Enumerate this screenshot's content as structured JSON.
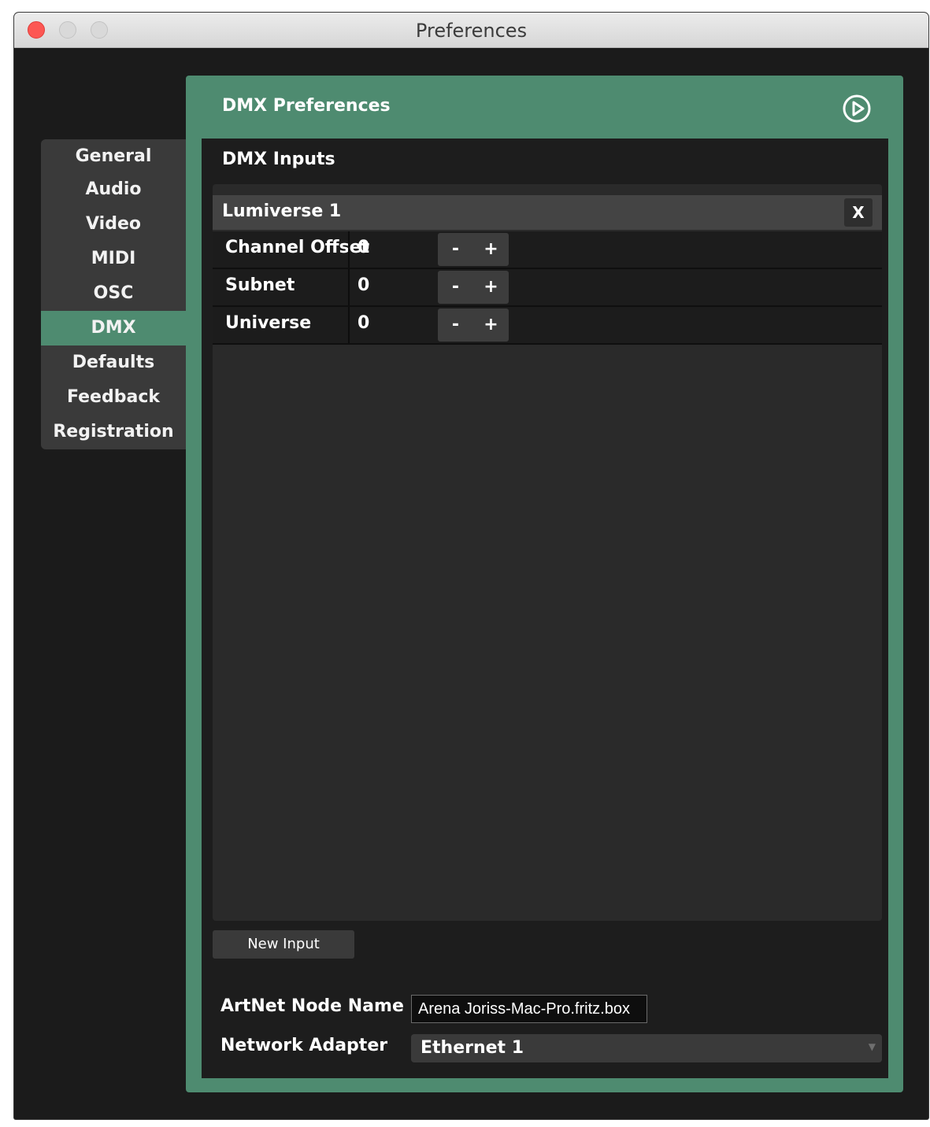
{
  "window": {
    "title": "Preferences"
  },
  "sidebar": {
    "items": [
      {
        "label": "General"
      },
      {
        "label": "Audio"
      },
      {
        "label": "Video"
      },
      {
        "label": "MIDI"
      },
      {
        "label": "OSC"
      },
      {
        "label": "DMX",
        "active": true
      },
      {
        "label": "Defaults"
      },
      {
        "label": "Feedback"
      },
      {
        "label": "Registration"
      }
    ]
  },
  "panel": {
    "title": "DMX Preferences",
    "icon": "play-circle-icon",
    "section_title": "DMX Inputs",
    "input": {
      "name": "Lumiverse 1",
      "remove_label": "X",
      "params": [
        {
          "label": "Channel Offset",
          "value": "0"
        },
        {
          "label": "Subnet",
          "value": "0"
        },
        {
          "label": "Universe",
          "value": "0"
        }
      ],
      "minus_label": "-",
      "plus_label": "+"
    },
    "new_input_label": "New Input",
    "artnet_label": "ArtNet Node Name",
    "artnet_value": "Arena Joriss-Mac-Pro.fritz.box",
    "adapter_label": "Network Adapter",
    "adapter_value": "Ethernet 1"
  },
  "colors": {
    "accent": "#4e8b70",
    "background": "#1d1d1d"
  }
}
